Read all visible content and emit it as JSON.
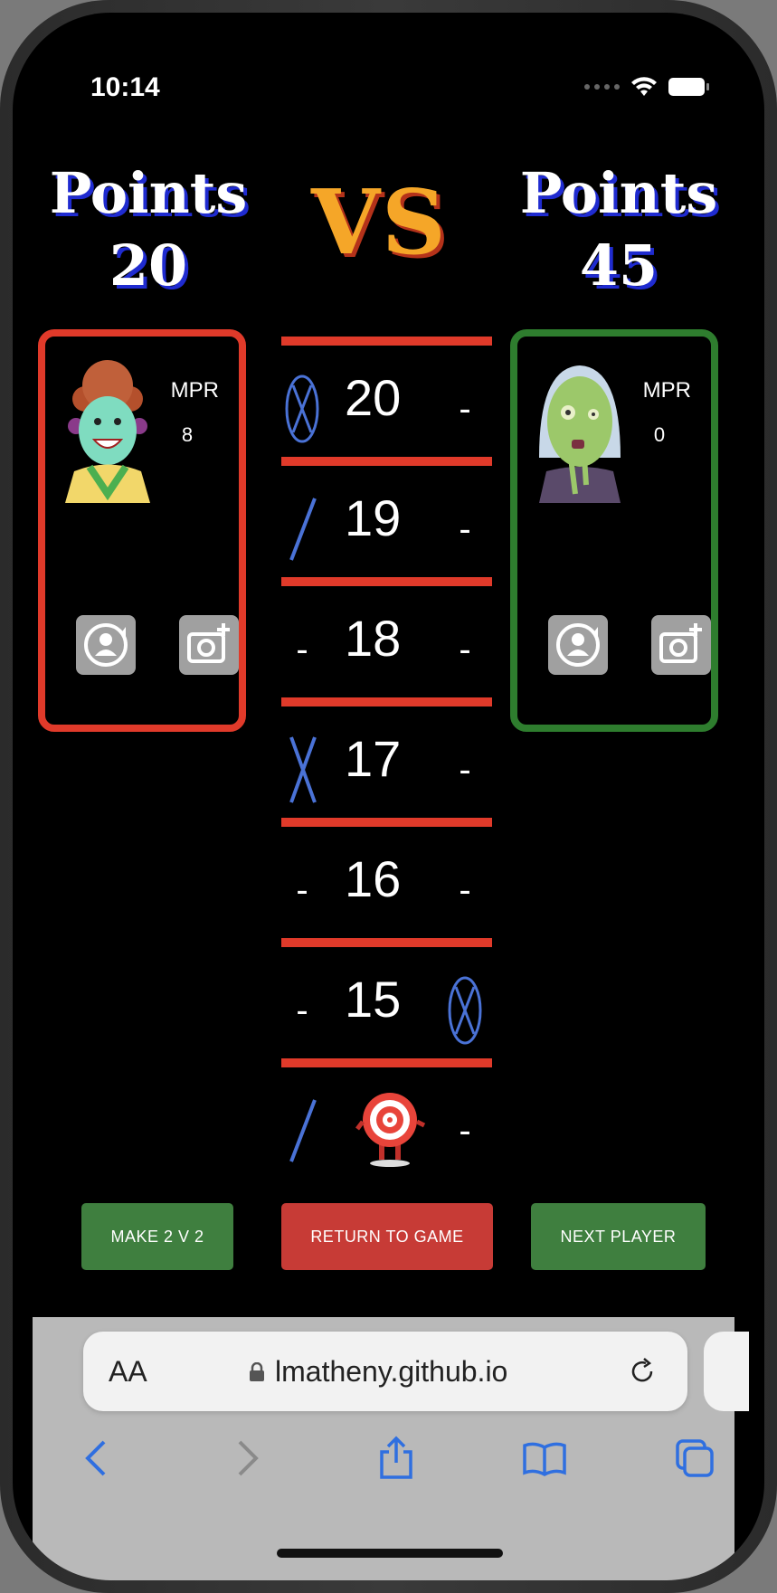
{
  "status_bar": {
    "time": "10:14"
  },
  "scores": {
    "left_label": "Points",
    "left_value": "20",
    "vs": "VS",
    "right_label": "Points",
    "right_value": "45"
  },
  "players": [
    {
      "mpr_label": "MPR",
      "mpr_value": "8",
      "border_color": "#e03a2a"
    },
    {
      "mpr_label": "MPR",
      "mpr_value": "0",
      "border_color": "#2e7d2e"
    }
  ],
  "board": {
    "rows": [
      {
        "number": "20",
        "left_mark": "closed",
        "right_mark": "-"
      },
      {
        "number": "19",
        "left_mark": "single",
        "right_mark": "-"
      },
      {
        "number": "18",
        "left_mark": "-",
        "right_mark": "-"
      },
      {
        "number": "17",
        "left_mark": "double",
        "right_mark": "-"
      },
      {
        "number": "16",
        "left_mark": "-",
        "right_mark": "-"
      },
      {
        "number": "15",
        "left_mark": "-",
        "right_mark": "closed"
      }
    ],
    "bull": {
      "left_mark": "single",
      "right_mark": "-"
    },
    "dash": "-",
    "line_color": "#e03a2a",
    "mark_color": "#4a72d6"
  },
  "actions": {
    "make_2v2": "MAKE 2 V 2",
    "return_to_game": "RETURN TO GAME",
    "next_player": "NEXT PLAYER"
  },
  "safari": {
    "text_size_label": "AA",
    "url": "lmatheny.github.io"
  }
}
